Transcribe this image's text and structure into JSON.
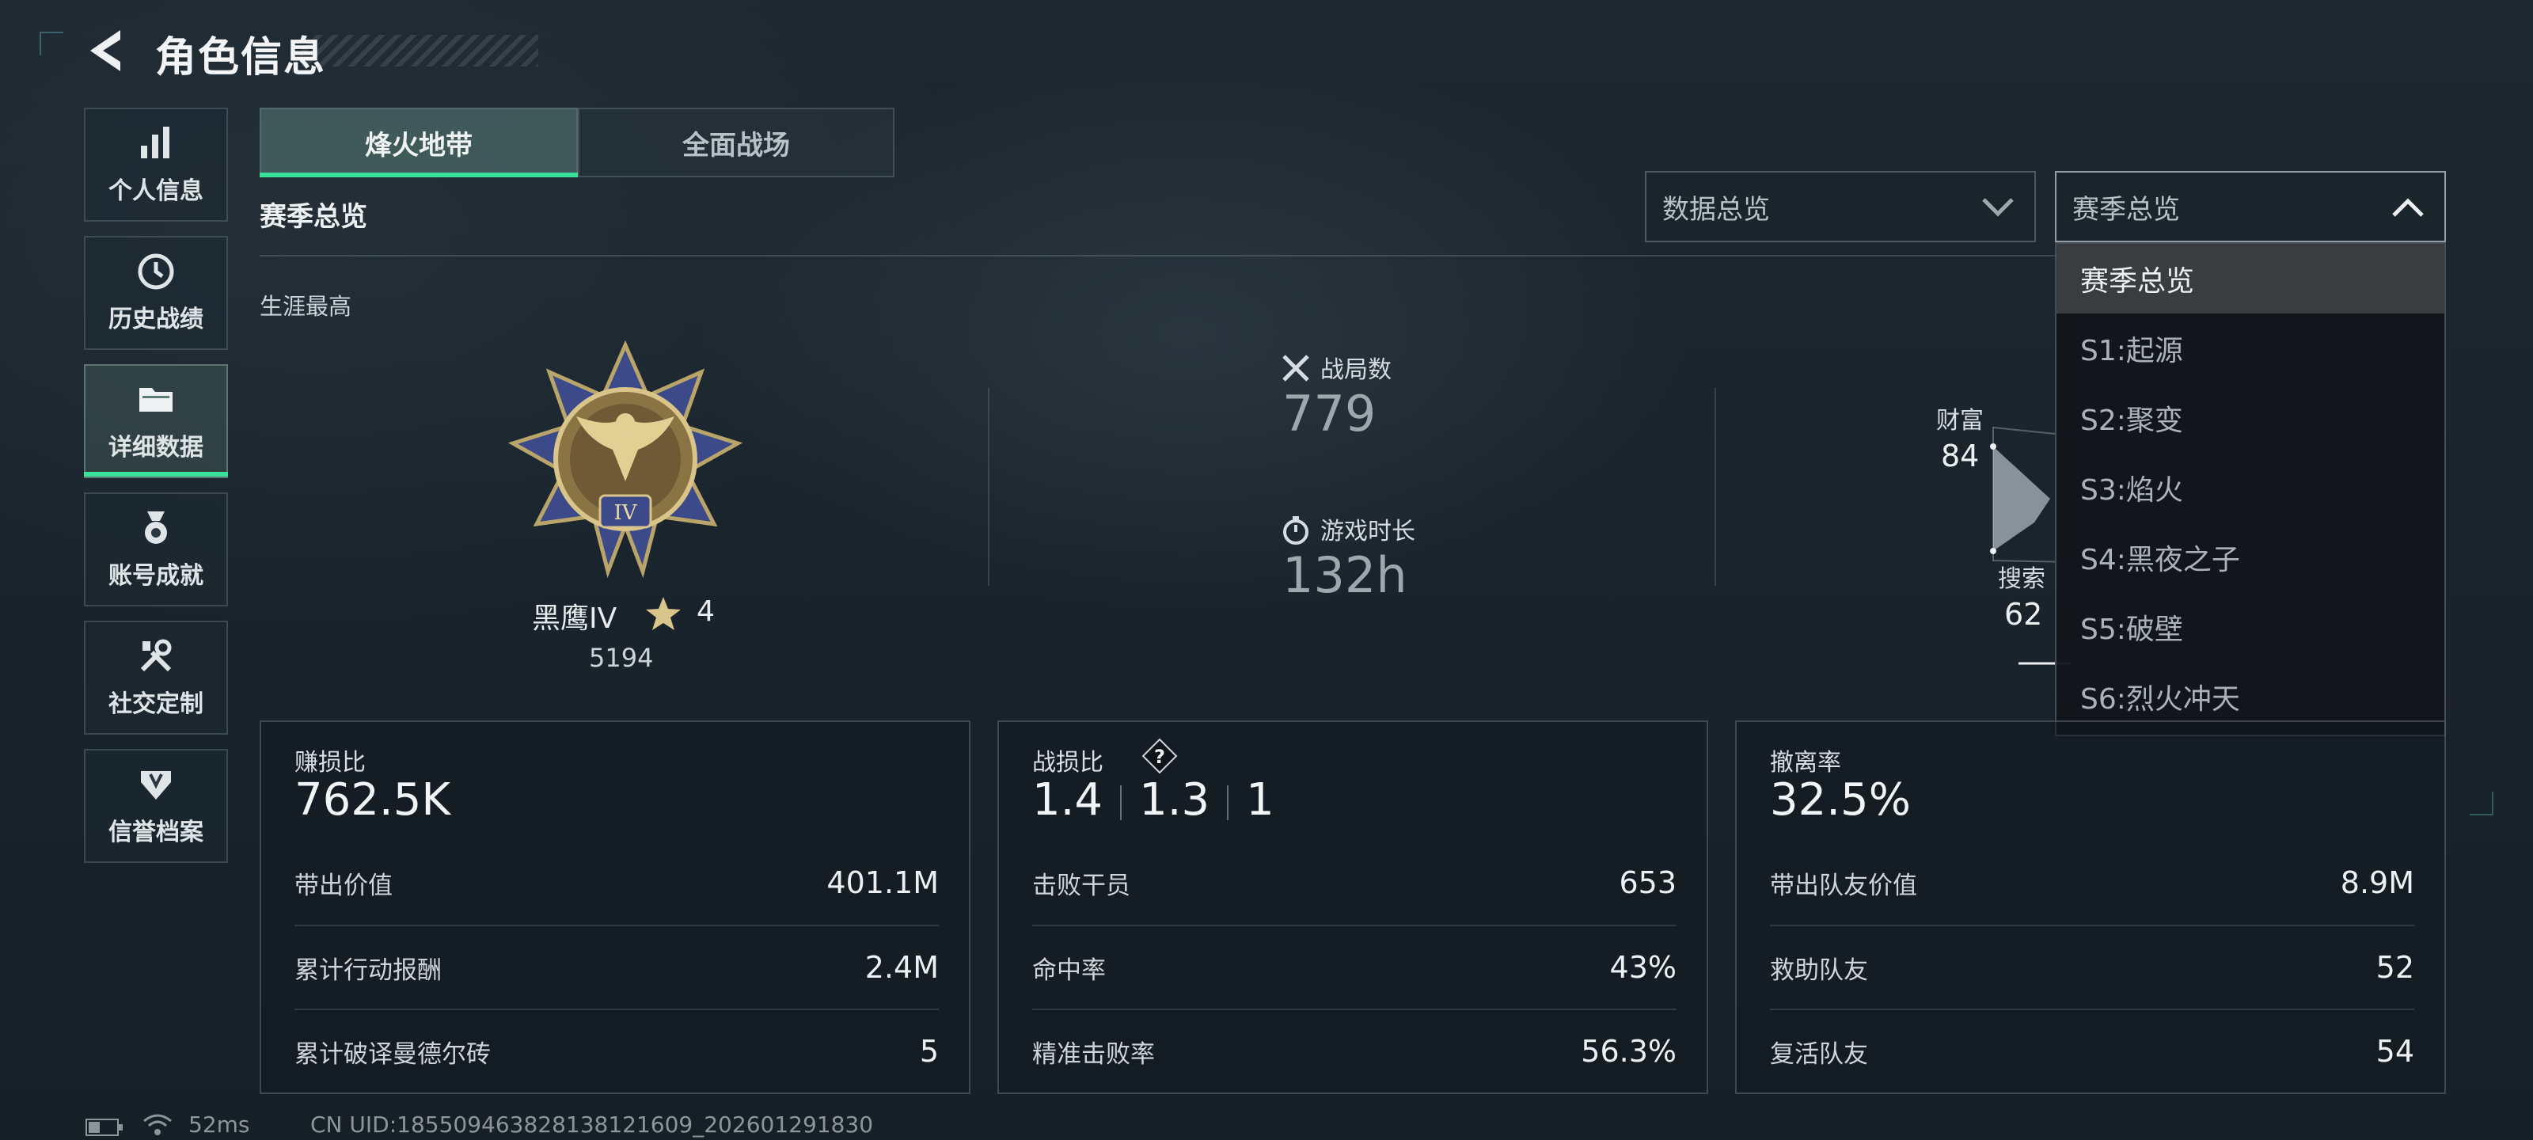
{
  "header": {
    "title": "角色信息"
  },
  "sidebar": {
    "items": [
      {
        "label": "个人信息",
        "icon": "bar-chart-icon"
      },
      {
        "label": "历史战绩",
        "icon": "clock-icon"
      },
      {
        "label": "详细数据",
        "icon": "folder-icon",
        "active": true
      },
      {
        "label": "账号成就",
        "icon": "medal-icon"
      },
      {
        "label": "社交定制",
        "icon": "tools-icon"
      },
      {
        "label": "信誉档案",
        "icon": "shield-icon"
      }
    ]
  },
  "tabs": [
    {
      "label": "烽火地带",
      "active": true
    },
    {
      "label": "全面战场",
      "active": false
    }
  ],
  "section_title": "赛季总览",
  "career_label": "生涯最高",
  "filters": {
    "data_dropdown": "数据总览",
    "season_dropdown": "赛季总览",
    "season_options": [
      "赛季总览",
      "S1:起源",
      "S2:聚变",
      "S3:焰火",
      "S4:黑夜之子",
      "S5:破壁",
      "S6:烈火冲天"
    ],
    "selected_option": "赛季总览"
  },
  "rank": {
    "name": "黑鹰IV",
    "stars": "4",
    "score": "5194",
    "medal_numeral": "IV"
  },
  "stats": {
    "matches": {
      "label": "战局数",
      "value": "779"
    },
    "playtime": {
      "label": "游戏时长",
      "value": "132h"
    }
  },
  "radar": {
    "wealth": {
      "label": "财富",
      "value": "84"
    },
    "search": {
      "label": "搜索",
      "value": "62"
    }
  },
  "cards": {
    "profit": {
      "label": "赚损比",
      "value": "762.5K",
      "rows": [
        {
          "label": "带出价值",
          "value": "401.1M"
        },
        {
          "label": "累计行动报酬",
          "value": "2.4M"
        },
        {
          "label": "累计破译曼德尔砖",
          "value": "5"
        }
      ]
    },
    "kd": {
      "label": "战损比",
      "values": [
        "1.4",
        "1.3",
        "1"
      ],
      "rows": [
        {
          "label": "击败干员",
          "value": "653"
        },
        {
          "label": "命中率",
          "value": "43%"
        },
        {
          "label": "精准击败率",
          "value": "56.3%"
        }
      ]
    },
    "extract": {
      "label": "撤离率",
      "value": "32.5%",
      "rows": [
        {
          "label": "带出队友价值",
          "value": "8.9M"
        },
        {
          "label": "救助队友",
          "value": "52"
        },
        {
          "label": "复活队友",
          "value": "54"
        }
      ]
    }
  },
  "footer": {
    "ping": "52ms",
    "uid": "CN UID:18550946382813812160​9_202601291830"
  },
  "colors": {
    "accent": "#38e29a",
    "background": "#1b252d"
  }
}
